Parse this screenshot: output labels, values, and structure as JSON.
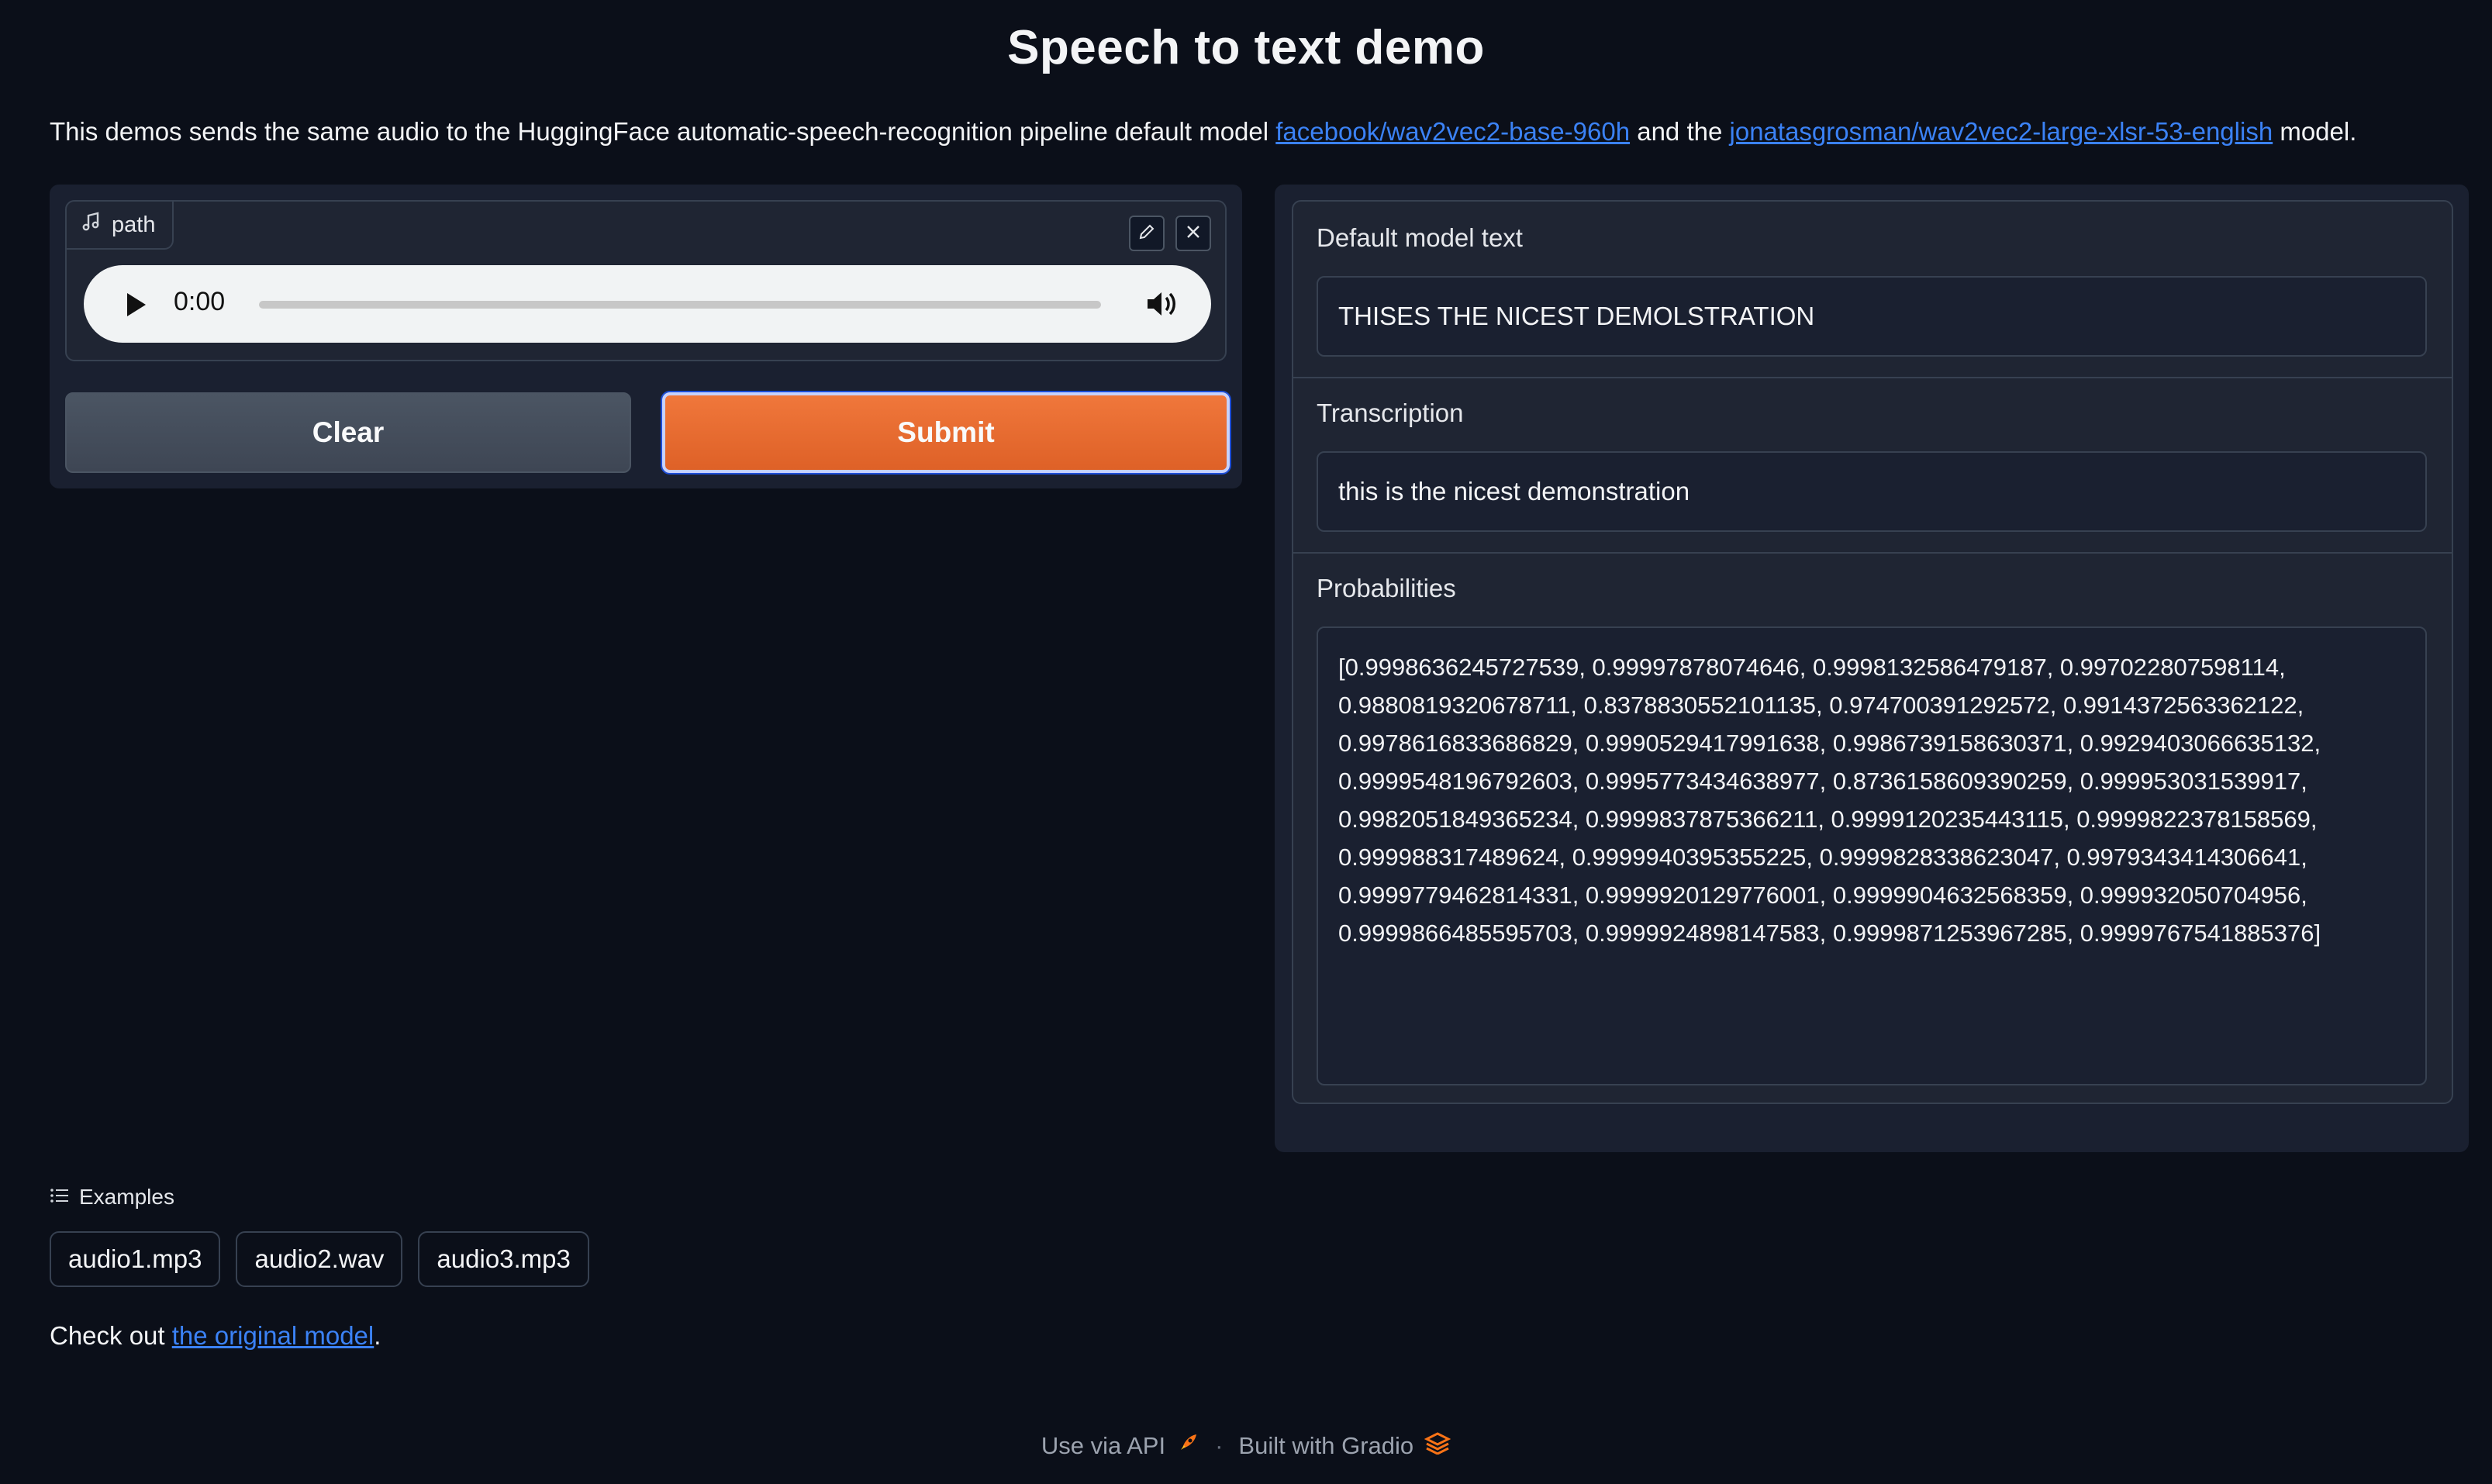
{
  "title": "Speech to text demo",
  "description": {
    "prefix": "This demos sends the same audio to the HuggingFace automatic-speech-recognition pipeline default model ",
    "link1": "facebook/wav2vec2-base-960h",
    "middle": " and the ",
    "link2": "jonatasgrosman/wav2vec2-large-xlsr-53-english",
    "suffix": " model."
  },
  "audio": {
    "label": "path",
    "time": "0:00",
    "edit_icon": "pencil-icon",
    "close_icon": "close-icon",
    "music_icon": "music-icon",
    "play_icon": "play-icon",
    "volume_icon": "volume-icon"
  },
  "buttons": {
    "clear": "Clear",
    "submit": "Submit"
  },
  "outputs": {
    "default_label": "Default model text",
    "default_value": "THISES THE NICEST DEMOLSTRATION",
    "transcription_label": "Transcription",
    "transcription_value": "this is the nicest demonstration",
    "probabilities_label": "Probabilities",
    "probabilities_value": "[0.9998636245727539, 0.99997878074646, 0.9998132586479187, 0.997022807598114,\n0.9880819320678711, 0.8378830552101135, 0.974700391292572, 0.9914372563362122,\n0.9978616833686829, 0.9990529417991638, 0.9986739158630371, 0.9929403066635132,\n0.9999548196792603, 0.9995773434638977, 0.8736158609390259, 0.999953031539917,\n0.9982051849365234, 0.9999837875366211, 0.9999120235443115, 0.9999822378158569,\n0.999988317489624, 0.9999940395355225, 0.9999828338623047, 0.9979343414306641,\n0.9999779462814331, 0.9999920129776001, 0.9999904632568359, 0.999932050704956,\n0.9999866485595703, 0.9999924898147583, 0.9999871253967285, 0.9999767541885376]"
  },
  "examples": {
    "heading": "Examples",
    "items": [
      "audio1.mp3",
      "audio2.wav",
      "audio3.mp3"
    ]
  },
  "checkout": {
    "prefix": "Check out ",
    "link": "the original model",
    "suffix": "."
  },
  "footer": {
    "api": "Use via API",
    "separator": "·",
    "built": "Built with Gradio"
  },
  "colors": {
    "background": "#0b0f19",
    "panel": "#1a2030",
    "accent": "#e8692f",
    "link": "#3b82f6"
  }
}
